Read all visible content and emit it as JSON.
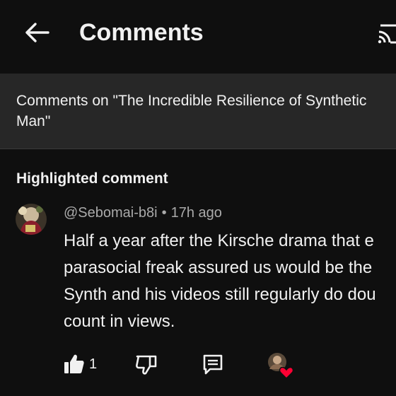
{
  "header": {
    "title": "Comments",
    "back_icon": "arrow-left-icon",
    "cast_icon": "cast-icon"
  },
  "context": {
    "text_line1": "Comments on \"The Incredible Resilience of Synthetic",
    "text_line2": "Man\""
  },
  "highlight": {
    "heading": "Highlighted comment",
    "comment": {
      "author": "@Sebomai-b8i",
      "separator": "•",
      "time": "17h ago",
      "lines": [
        "Half a year after the Kirsche drama that e",
        "parasocial freak assured us would be the",
        "Synth and his videos still regularly do dou",
        "count in views."
      ],
      "likes": "1",
      "icons": {
        "like": "thumbs-up-icon",
        "dislike": "thumbs-down-icon",
        "reply": "reply-comment-icon",
        "hearted": "creator-heart-icon"
      }
    }
  },
  "colors": {
    "background": "#0f0f0f",
    "context_bar": "#272727",
    "text": "#f1f1f1",
    "secondary": "#aaaaaa",
    "heart": "#ff0033"
  }
}
